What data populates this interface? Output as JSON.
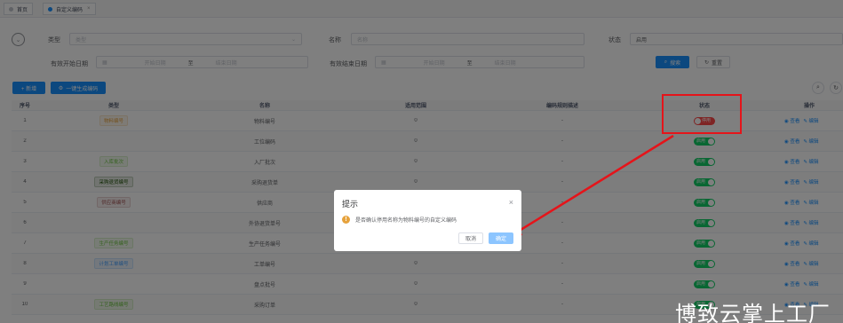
{
  "tabs": [
    {
      "label": "首页",
      "dot": "#c0c4cc"
    },
    {
      "label": "自定义编码",
      "dot": "#1890ff",
      "close": "×"
    }
  ],
  "search": {
    "type_label": "类型",
    "type_placeholder": "类型",
    "name_label": "名称",
    "name_placeholder": "名称",
    "status_label": "状态",
    "status_value": "启用",
    "start_label": "有效开始日期",
    "start_from": "开始日期",
    "start_sep": "至",
    "start_to": "结束日期",
    "end_label": "有效结束日期",
    "end_from": "开始日期",
    "end_sep": "至",
    "end_to": "结束日期",
    "search_btn": "搜索",
    "reset_btn": "重置"
  },
  "toolbar": {
    "add_btn": "+ 新增",
    "gen_btn": "一键生成编码"
  },
  "table": {
    "headers": [
      "序号",
      "类型",
      "名称",
      "适用范围",
      "编码规则描述",
      "状态",
      "操作"
    ],
    "rows": [
      {
        "no": "1",
        "type": "物料编号",
        "tag_color": "#e6a23c",
        "name": "物料编号",
        "scope": "0",
        "desc": "-",
        "status": "停用",
        "on": false
      },
      {
        "no": "2",
        "type": "",
        "tag_color": "",
        "name": "工位编码",
        "scope": "0",
        "desc": "-",
        "status": "启用",
        "on": true
      },
      {
        "no": "3",
        "type": "入库批次",
        "tag_color": "#67c23a",
        "name": "入厂批次",
        "scope": "0",
        "desc": "-",
        "status": "启用",
        "on": true
      },
      {
        "no": "4",
        "type": "采购退货编号",
        "tag_color": "#1a4d00",
        "name": "采购退货单",
        "scope": "0",
        "desc": "-",
        "status": "启用",
        "on": true
      },
      {
        "no": "5",
        "type": "供应商编号",
        "tag_color": "#a05050",
        "name": "供应商",
        "scope": "0",
        "desc": "-",
        "status": "启用",
        "on": true
      },
      {
        "no": "6",
        "type": "",
        "tag_color": "",
        "name": "外协退货单号",
        "scope": "0",
        "desc": "-",
        "status": "启用",
        "on": true
      },
      {
        "no": "7",
        "type": "生产任务编号",
        "tag_color": "#67c23a",
        "name": "生产任务编号",
        "scope": "0",
        "desc": "-",
        "status": "启用",
        "on": true
      },
      {
        "no": "8",
        "type": "计划工单编号",
        "tag_color": "#409eff",
        "name": "工单编号",
        "scope": "0",
        "desc": "-",
        "status": "启用",
        "on": true
      },
      {
        "no": "9",
        "type": "",
        "tag_color": "",
        "name": "盘点批号",
        "scope": "0",
        "desc": "-",
        "status": "启用",
        "on": true
      },
      {
        "no": "10",
        "type": "工艺路线编号",
        "tag_color": "#67c23a",
        "name": "采购订单",
        "scope": "0",
        "desc": "-",
        "status": "启用",
        "on": true
      }
    ],
    "op_view": "查看",
    "op_edit": "编辑"
  },
  "dialog": {
    "title": "提示",
    "close": "×",
    "message": "是否确认停用名称为物料编号的自定义编码",
    "cancel": "取消",
    "confirm": "确定"
  },
  "colors": {
    "primary": "#1890ff",
    "success": "#13ce66",
    "danger": "#ff4949",
    "annotation": "#e5141a"
  },
  "watermark": "博致云掌上工厂"
}
